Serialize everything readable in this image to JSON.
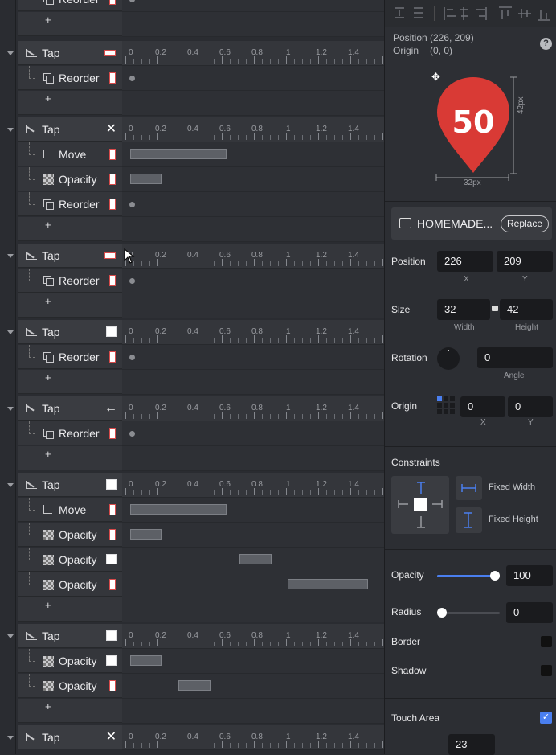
{
  "timeline": {
    "ruler": [
      "0",
      "0.2",
      "0.4",
      "0.6",
      "0.8",
      "1",
      "1.2",
      "1.4"
    ],
    "top_fragment": {
      "label": "Reorder",
      "plus": "+"
    },
    "groups": [
      {
        "title": "Tap",
        "marker": "flat",
        "rows": [
          {
            "label": "Reorder",
            "icon": "reorder",
            "swatch": "red"
          }
        ],
        "plus": "+"
      },
      {
        "title": "Tap",
        "marker": "x",
        "rows": [
          {
            "label": "Move",
            "icon": "move",
            "swatch": "red"
          },
          {
            "label": "Opacity",
            "icon": "opacity",
            "swatch": "red"
          },
          {
            "label": "Reorder",
            "icon": "reorder",
            "swatch": "red"
          }
        ],
        "plus": "+"
      },
      {
        "title": "Tap",
        "marker": "flat",
        "rows": [
          {
            "label": "Reorder",
            "icon": "reorder",
            "swatch": "red"
          }
        ],
        "plus": "+"
      },
      {
        "title": "Tap",
        "marker": "sq",
        "rows": [
          {
            "label": "Reorder",
            "icon": "reorder",
            "swatch": "red"
          }
        ],
        "plus": "+"
      },
      {
        "title": "Tap",
        "marker": "arrow",
        "rows": [
          {
            "label": "Reorder",
            "icon": "reorder",
            "swatch": "red"
          }
        ],
        "plus": "+"
      },
      {
        "title": "Tap",
        "marker": "sq",
        "rows": [
          {
            "label": "Move",
            "icon": "move",
            "swatch": "red"
          },
          {
            "label": "Opacity",
            "icon": "opacity",
            "swatch": "red"
          },
          {
            "label": "Opacity",
            "icon": "opacity",
            "swatch": "sq"
          },
          {
            "label": "Opacity",
            "icon": "opacity",
            "swatch": "red"
          }
        ],
        "plus": "+"
      },
      {
        "title": "Tap",
        "marker": "sq",
        "rows": [
          {
            "label": "Opacity",
            "icon": "opacity",
            "swatch": "sq"
          },
          {
            "label": "Opacity",
            "icon": "opacity",
            "swatch": "red"
          }
        ],
        "plus": "+"
      },
      {
        "title": "Tap",
        "marker": "x",
        "rows": [],
        "plus": ""
      }
    ]
  },
  "inspector": {
    "position_label": "Position",
    "position_value": "(226, 209)",
    "origin_label": "Origin",
    "origin_value": "(0, 0)",
    "help": "?",
    "preview_number": "50",
    "preview_height": "42px",
    "preview_width": "32px",
    "image_name": "HOMEMADE...",
    "replace_label": "Replace",
    "pos_label": "Position",
    "pos_x": "226",
    "pos_y": "209",
    "x_label": "X",
    "y_label": "Y",
    "size_label": "Size",
    "size_w": "32",
    "size_h": "42",
    "width_label": "Width",
    "height_label": "Height",
    "rotation_label": "Rotation",
    "rotation_value": "0",
    "angle_label": "Angle",
    "origin2_label": "Origin",
    "origin_x": "0",
    "origin_y": "0",
    "constraints_label": "Constraints",
    "fixed_width": "Fixed Width",
    "fixed_height": "Fixed Height",
    "opacity_label": "Opacity",
    "opacity_value": "100",
    "radius_label": "Radius",
    "radius_value": "0",
    "border_label": "Border",
    "shadow_label": "Shadow",
    "touch_label": "Touch Area",
    "touch_value": "23",
    "accent": "#4a7ff0",
    "pin_color": "#d93a35"
  }
}
